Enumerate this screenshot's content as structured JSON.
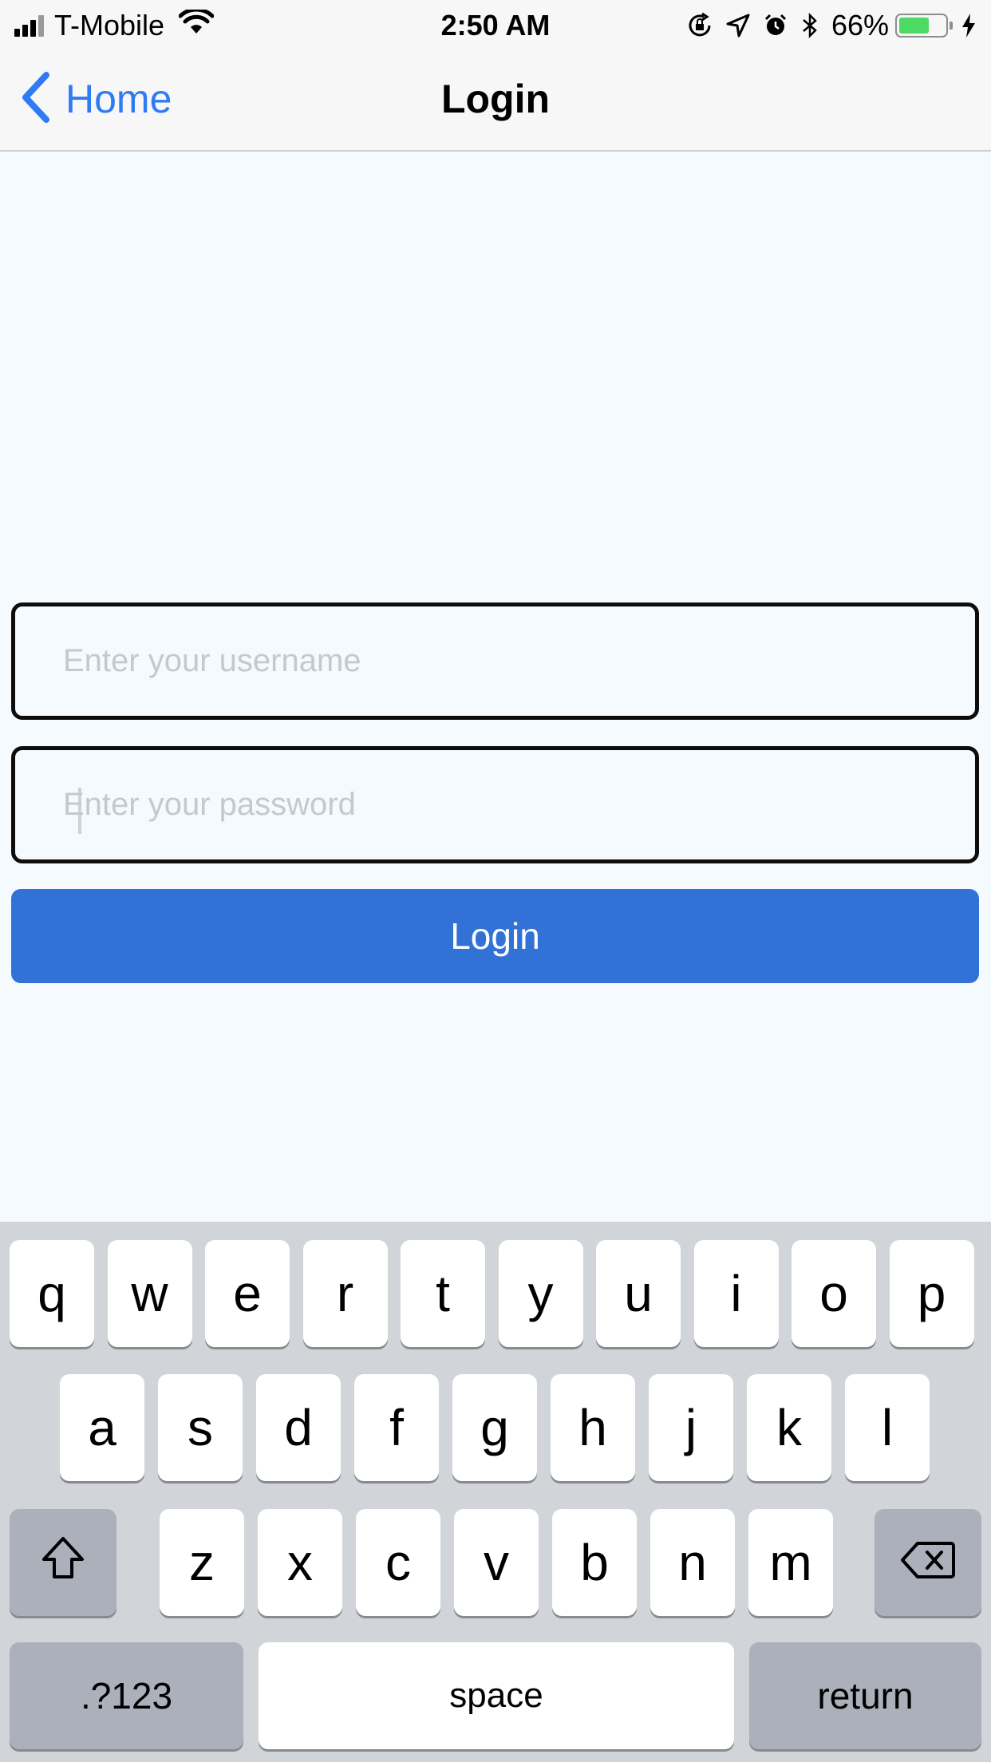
{
  "status_bar": {
    "carrier": "T-Mobile",
    "time": "2:50 AM",
    "battery_percent": "66%",
    "battery_level": 0.66,
    "icons": [
      "signal-icon",
      "wifi-icon",
      "orientation-lock-icon",
      "location-icon",
      "alarm-icon",
      "bluetooth-icon",
      "battery-icon",
      "charging-icon"
    ]
  },
  "nav": {
    "back_label": "Home",
    "title": "Login"
  },
  "form": {
    "username_placeholder": "Enter your username",
    "username_value": "",
    "password_placeholder": "Enter your password",
    "password_value": "",
    "login_label": "Login",
    "login_color": "#3272d6"
  },
  "keyboard": {
    "row1": [
      "q",
      "w",
      "e",
      "r",
      "t",
      "y",
      "u",
      "i",
      "o",
      "p"
    ],
    "row2": [
      "a",
      "s",
      "d",
      "f",
      "g",
      "h",
      "j",
      "k",
      "l"
    ],
    "row3": [
      "z",
      "x",
      "c",
      "v",
      "b",
      "n",
      "m"
    ],
    "numbers_label": ".?123",
    "space_label": "space",
    "return_label": "return"
  }
}
